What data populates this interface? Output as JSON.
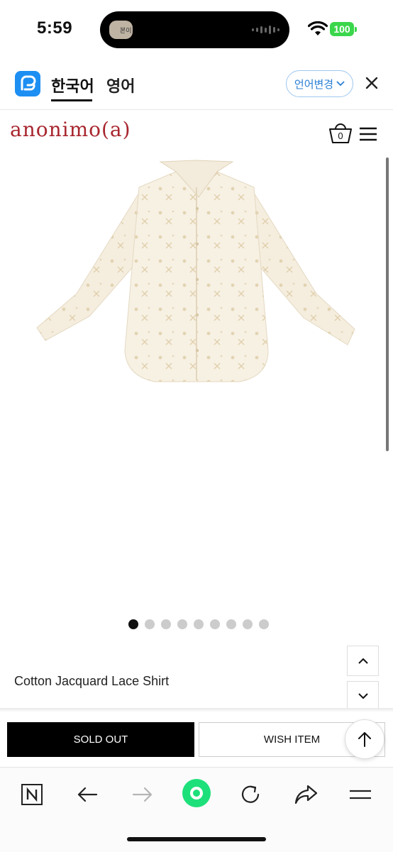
{
  "status_bar": {
    "time": "5:59",
    "battery": "100",
    "island_thumb_text": "본이"
  },
  "translate_bar": {
    "lang_ko": "한국어",
    "lang_en": "영어",
    "change_label": "언어변경"
  },
  "site": {
    "logo": "anonimo(a)",
    "cart_count": "0"
  },
  "product": {
    "title": "Cotton Jacquard Lace Shirt",
    "image_count": 9,
    "active_image": 1,
    "sold_out_label": "SOLD OUT",
    "wish_label": "WISH ITEM"
  },
  "colors": {
    "logo": "#a8262e",
    "accent_blue": "#2a7fd4",
    "battery": "#3ad64b",
    "browser_green": "#1de07a"
  },
  "toolbar": {
    "icons": [
      "naver-n-icon",
      "back-arrow-icon",
      "forward-arrow-icon",
      "green-home-icon",
      "reload-icon",
      "share-icon",
      "menu-icon"
    ]
  }
}
